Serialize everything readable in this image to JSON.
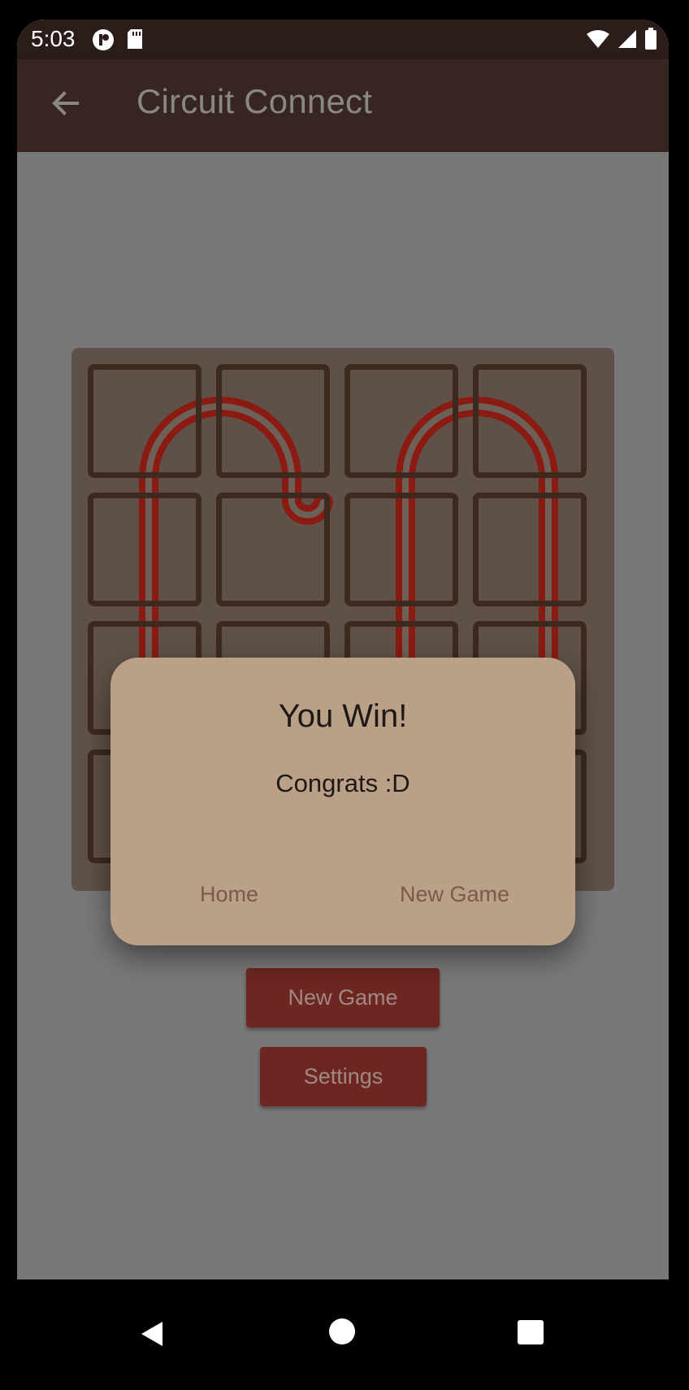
{
  "status_bar": {
    "time": "5:03",
    "left_icons": [
      "data-saver-icon",
      "sd-card-icon"
    ],
    "right_icons": [
      "wifi-icon",
      "signal-icon",
      "battery-icon"
    ]
  },
  "app_bar": {
    "back_icon": "arrow-back-icon",
    "title": "Circuit Connect"
  },
  "board": {
    "rows": 4,
    "cols": 4,
    "wire_color": "#8a1a12",
    "tile_border_color": "#3d2a1f"
  },
  "buttons": {
    "new_game": "New Game",
    "settings": "Settings"
  },
  "dialog": {
    "title": "You Win!",
    "message": "Congrats :D",
    "home_label": "Home",
    "new_game_label": "New Game"
  },
  "nav_bar": {
    "icons": [
      "back-triangle-icon",
      "home-circle-icon",
      "recents-square-icon"
    ]
  },
  "colors": {
    "app_bar": "#362520",
    "status_bar": "#2c1c1a",
    "scrim_background": "#787878",
    "board": "#5f5147",
    "button": "#6e2620",
    "dialog": "#b9a087"
  }
}
